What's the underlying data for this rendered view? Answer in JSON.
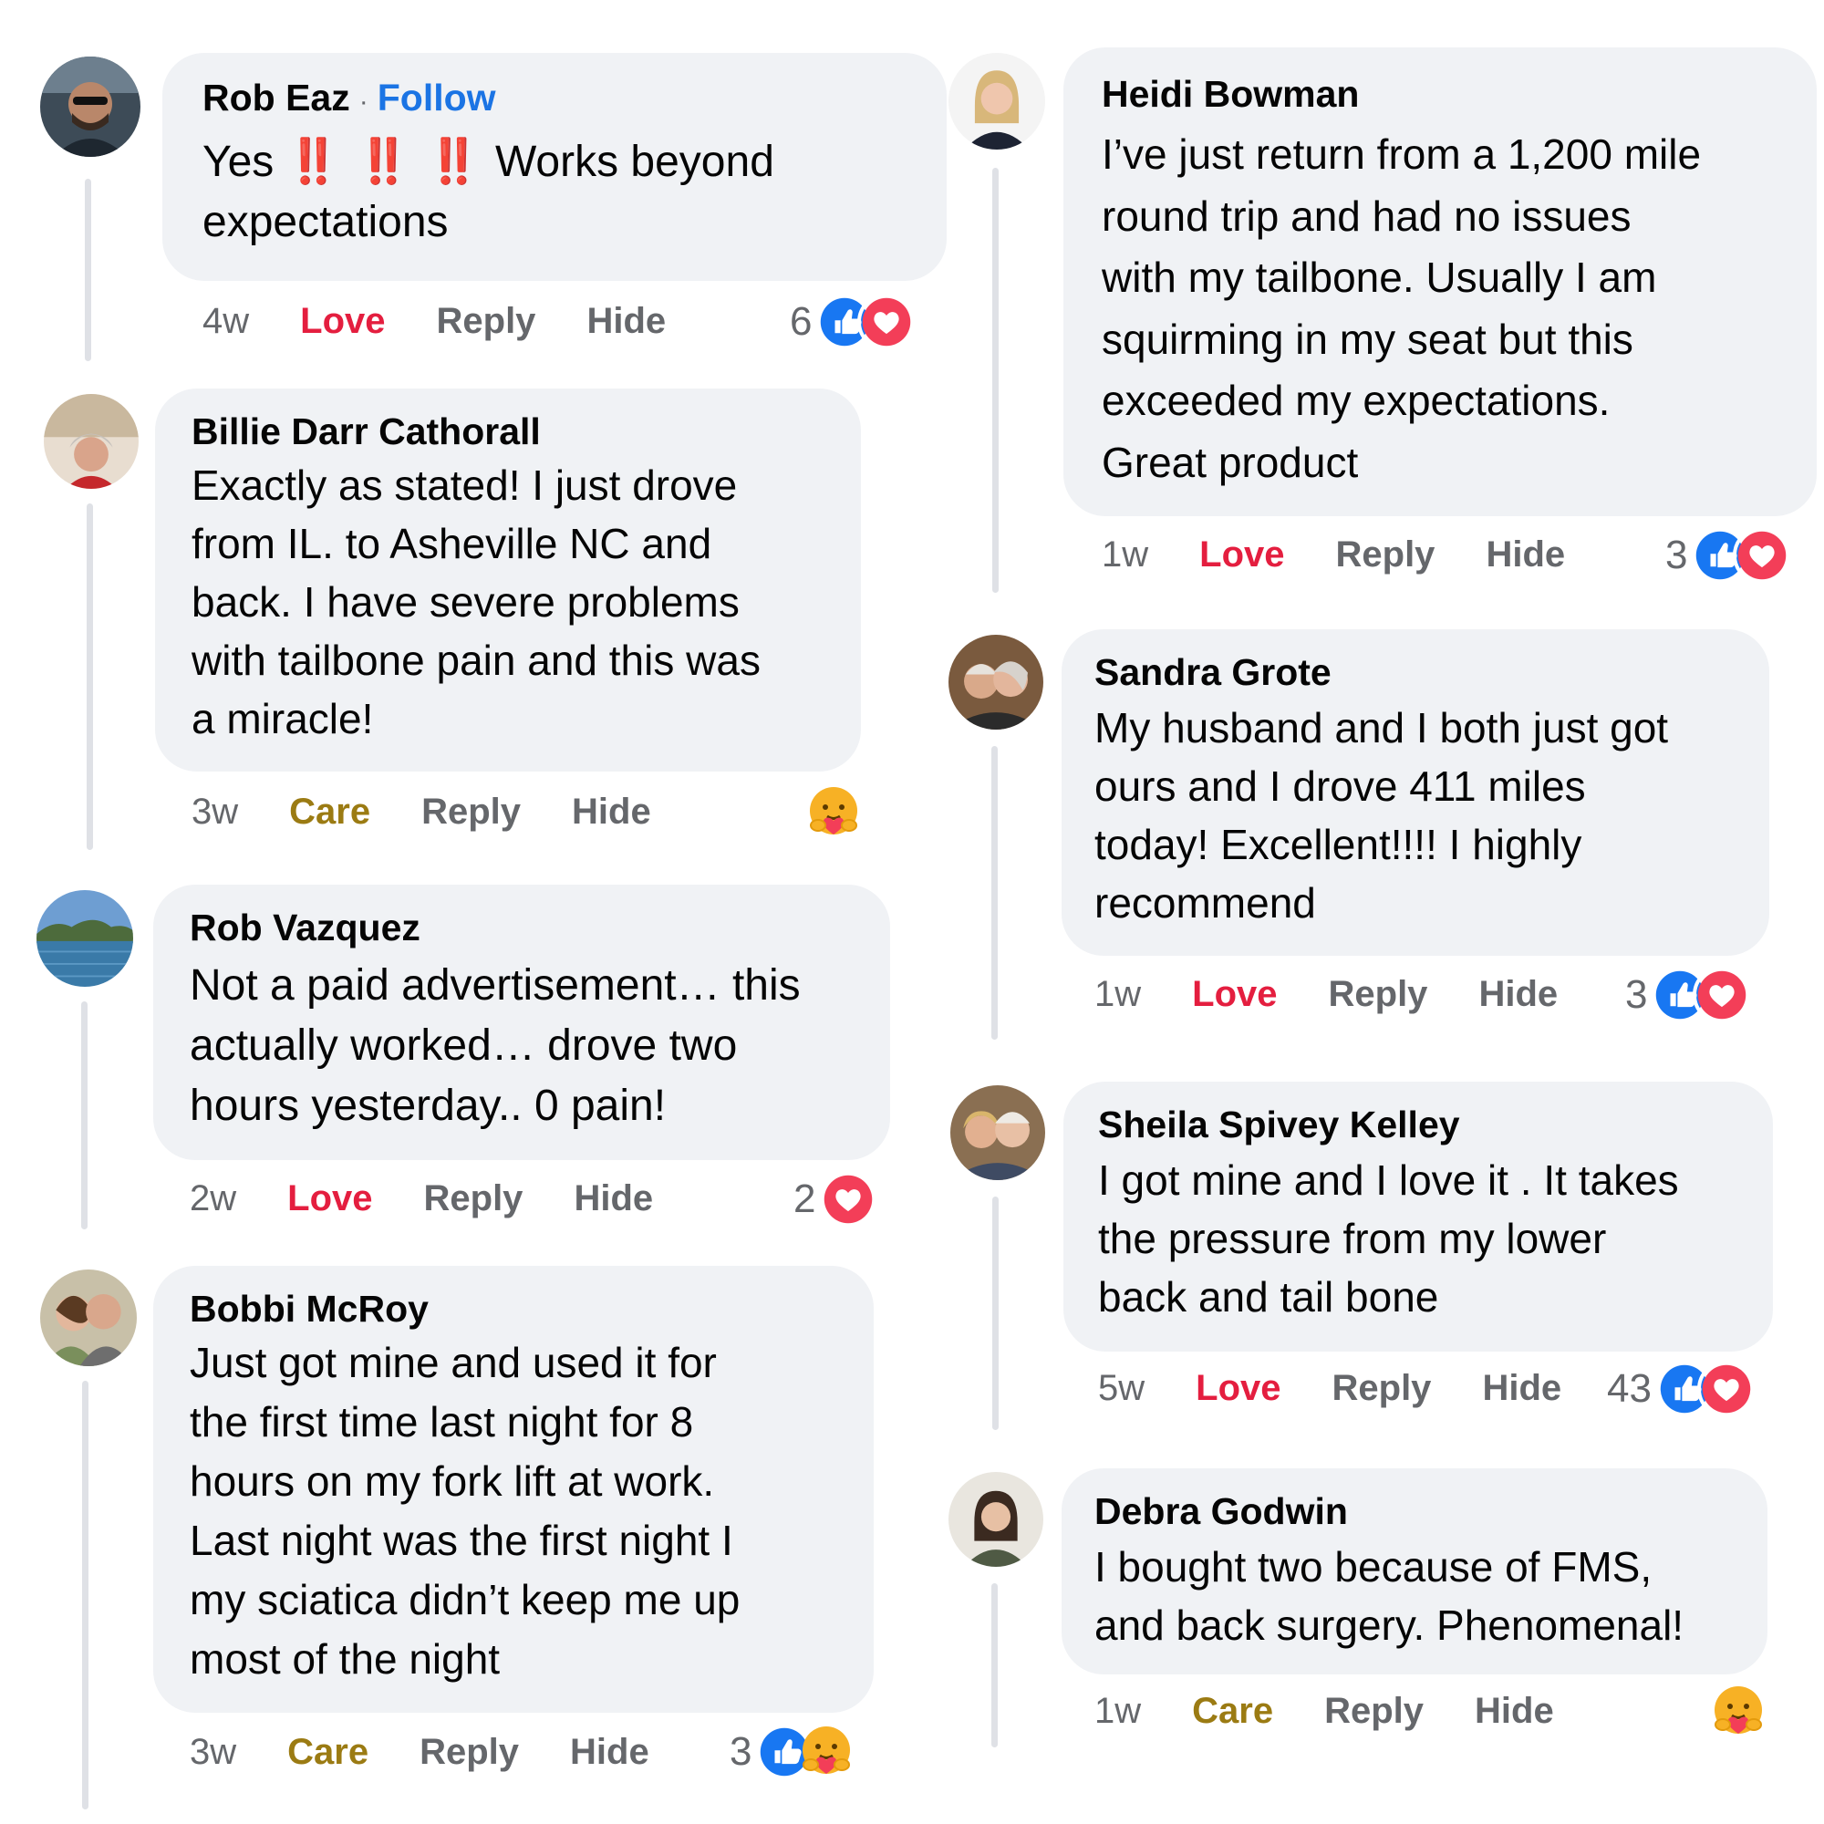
{
  "comments": [
    {
      "name": "Rob Eaz",
      "separator": "·",
      "follow": "Follow",
      "text_pre": "Yes",
      "emphasis": "‼️ ‼️ ‼️",
      "text_post": " Works beyond\nexpectations",
      "time": "4w",
      "reaction_label": "Love",
      "reply": "Reply",
      "hide": "Hide",
      "count": "6",
      "icons": [
        "like-icon",
        "love-icon"
      ]
    },
    {
      "name": "Billie Darr Cathorall",
      "text": "Exactly as stated! I just drove\nfrom IL. to Asheville NC and\nback. I have severe problems\nwith tailbone pain and this was\na miracle!",
      "time": "3w",
      "reaction_label": "Care",
      "reply": "Reply",
      "hide": "Hide",
      "count": "",
      "icons": [
        "care-icon"
      ]
    },
    {
      "name": "Rob Vazquez",
      "text": "Not a paid advertisement… this\nactually worked… drove two\nhours yesterday.. 0 pain!",
      "time": "2w",
      "reaction_label": "Love",
      "reply": "Reply",
      "hide": "Hide",
      "count": "2",
      "icons": [
        "love-icon"
      ]
    },
    {
      "name": "Bobbi McRoy",
      "text": "Just got mine and used it for\nthe first time last night for 8\nhours on my fork lift at work.\nLast night was the first night I\nmy sciatica didn’t keep me up\nmost of the night",
      "time": "3w",
      "reaction_label": "Care",
      "reply": "Reply",
      "hide": "Hide",
      "count": "3",
      "icons": [
        "like-icon",
        "care-icon"
      ]
    },
    {
      "name": "Heidi Bowman",
      "text": "I’ve just return from a 1,200 mile\nround trip and had no issues\nwith my tailbone. Usually I am\nsquirming in my seat but this\nexceeded my expectations.\nGreat product",
      "time": "1w",
      "reaction_label": "Love",
      "reply": "Reply",
      "hide": "Hide",
      "count": "3",
      "icons": [
        "like-icon",
        "love-icon"
      ]
    },
    {
      "name": "Sandra Grote",
      "text": "My husband and I both just got\nours and I drove 411 miles\ntoday! Excellent!!!! I highly\nrecommend",
      "time": "1w",
      "reaction_label": "Love",
      "reply": "Reply",
      "hide": "Hide",
      "count": "3",
      "icons": [
        "like-icon",
        "love-icon"
      ]
    },
    {
      "name": "Sheila Spivey Kelley",
      "text": "I got mine and I love it . It takes\nthe pressure from my lower\nback and tail bone",
      "time": "5w",
      "reaction_label": "Love",
      "reply": "Reply",
      "hide": "Hide",
      "count": "43",
      "icons": [
        "like-icon",
        "love-icon"
      ]
    },
    {
      "name": "Debra Godwin",
      "text": "I bought two because of FMS,\nand back surgery. Phenomenal!",
      "time": "1w",
      "reaction_label": "Care",
      "reply": "Reply",
      "hide": "Hide",
      "count": "",
      "icons": [
        "care-icon"
      ]
    }
  ],
  "colors": {
    "like": "#1877f2",
    "love": "#f33e58",
    "care": "#f7b125",
    "love_label": "#e41e3f",
    "care_label": "#9b7b13",
    "follow": "#1b74e4",
    "bubble": "#f0f2f5",
    "muted": "#65676b"
  }
}
